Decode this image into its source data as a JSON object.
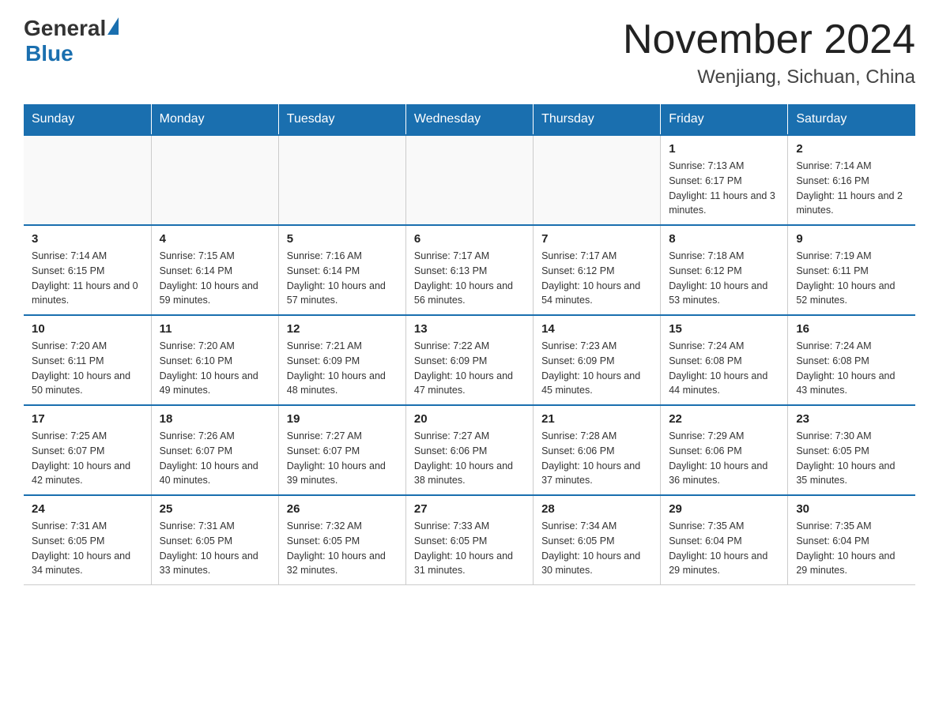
{
  "header": {
    "logo_general": "General",
    "logo_blue": "Blue",
    "month_title": "November 2024",
    "location": "Wenjiang, Sichuan, China"
  },
  "days_of_week": [
    "Sunday",
    "Monday",
    "Tuesday",
    "Wednesday",
    "Thursday",
    "Friday",
    "Saturday"
  ],
  "weeks": [
    [
      {
        "day": "",
        "info": ""
      },
      {
        "day": "",
        "info": ""
      },
      {
        "day": "",
        "info": ""
      },
      {
        "day": "",
        "info": ""
      },
      {
        "day": "",
        "info": ""
      },
      {
        "day": "1",
        "info": "Sunrise: 7:13 AM\nSunset: 6:17 PM\nDaylight: 11 hours and 3 minutes."
      },
      {
        "day": "2",
        "info": "Sunrise: 7:14 AM\nSunset: 6:16 PM\nDaylight: 11 hours and 2 minutes."
      }
    ],
    [
      {
        "day": "3",
        "info": "Sunrise: 7:14 AM\nSunset: 6:15 PM\nDaylight: 11 hours and 0 minutes."
      },
      {
        "day": "4",
        "info": "Sunrise: 7:15 AM\nSunset: 6:14 PM\nDaylight: 10 hours and 59 minutes."
      },
      {
        "day": "5",
        "info": "Sunrise: 7:16 AM\nSunset: 6:14 PM\nDaylight: 10 hours and 57 minutes."
      },
      {
        "day": "6",
        "info": "Sunrise: 7:17 AM\nSunset: 6:13 PM\nDaylight: 10 hours and 56 minutes."
      },
      {
        "day": "7",
        "info": "Sunrise: 7:17 AM\nSunset: 6:12 PM\nDaylight: 10 hours and 54 minutes."
      },
      {
        "day": "8",
        "info": "Sunrise: 7:18 AM\nSunset: 6:12 PM\nDaylight: 10 hours and 53 minutes."
      },
      {
        "day": "9",
        "info": "Sunrise: 7:19 AM\nSunset: 6:11 PM\nDaylight: 10 hours and 52 minutes."
      }
    ],
    [
      {
        "day": "10",
        "info": "Sunrise: 7:20 AM\nSunset: 6:11 PM\nDaylight: 10 hours and 50 minutes."
      },
      {
        "day": "11",
        "info": "Sunrise: 7:20 AM\nSunset: 6:10 PM\nDaylight: 10 hours and 49 minutes."
      },
      {
        "day": "12",
        "info": "Sunrise: 7:21 AM\nSunset: 6:09 PM\nDaylight: 10 hours and 48 minutes."
      },
      {
        "day": "13",
        "info": "Sunrise: 7:22 AM\nSunset: 6:09 PM\nDaylight: 10 hours and 47 minutes."
      },
      {
        "day": "14",
        "info": "Sunrise: 7:23 AM\nSunset: 6:09 PM\nDaylight: 10 hours and 45 minutes."
      },
      {
        "day": "15",
        "info": "Sunrise: 7:24 AM\nSunset: 6:08 PM\nDaylight: 10 hours and 44 minutes."
      },
      {
        "day": "16",
        "info": "Sunrise: 7:24 AM\nSunset: 6:08 PM\nDaylight: 10 hours and 43 minutes."
      }
    ],
    [
      {
        "day": "17",
        "info": "Sunrise: 7:25 AM\nSunset: 6:07 PM\nDaylight: 10 hours and 42 minutes."
      },
      {
        "day": "18",
        "info": "Sunrise: 7:26 AM\nSunset: 6:07 PM\nDaylight: 10 hours and 40 minutes."
      },
      {
        "day": "19",
        "info": "Sunrise: 7:27 AM\nSunset: 6:07 PM\nDaylight: 10 hours and 39 minutes."
      },
      {
        "day": "20",
        "info": "Sunrise: 7:27 AM\nSunset: 6:06 PM\nDaylight: 10 hours and 38 minutes."
      },
      {
        "day": "21",
        "info": "Sunrise: 7:28 AM\nSunset: 6:06 PM\nDaylight: 10 hours and 37 minutes."
      },
      {
        "day": "22",
        "info": "Sunrise: 7:29 AM\nSunset: 6:06 PM\nDaylight: 10 hours and 36 minutes."
      },
      {
        "day": "23",
        "info": "Sunrise: 7:30 AM\nSunset: 6:05 PM\nDaylight: 10 hours and 35 minutes."
      }
    ],
    [
      {
        "day": "24",
        "info": "Sunrise: 7:31 AM\nSunset: 6:05 PM\nDaylight: 10 hours and 34 minutes."
      },
      {
        "day": "25",
        "info": "Sunrise: 7:31 AM\nSunset: 6:05 PM\nDaylight: 10 hours and 33 minutes."
      },
      {
        "day": "26",
        "info": "Sunrise: 7:32 AM\nSunset: 6:05 PM\nDaylight: 10 hours and 32 minutes."
      },
      {
        "day": "27",
        "info": "Sunrise: 7:33 AM\nSunset: 6:05 PM\nDaylight: 10 hours and 31 minutes."
      },
      {
        "day": "28",
        "info": "Sunrise: 7:34 AM\nSunset: 6:05 PM\nDaylight: 10 hours and 30 minutes."
      },
      {
        "day": "29",
        "info": "Sunrise: 7:35 AM\nSunset: 6:04 PM\nDaylight: 10 hours and 29 minutes."
      },
      {
        "day": "30",
        "info": "Sunrise: 7:35 AM\nSunset: 6:04 PM\nDaylight: 10 hours and 29 minutes."
      }
    ]
  ]
}
